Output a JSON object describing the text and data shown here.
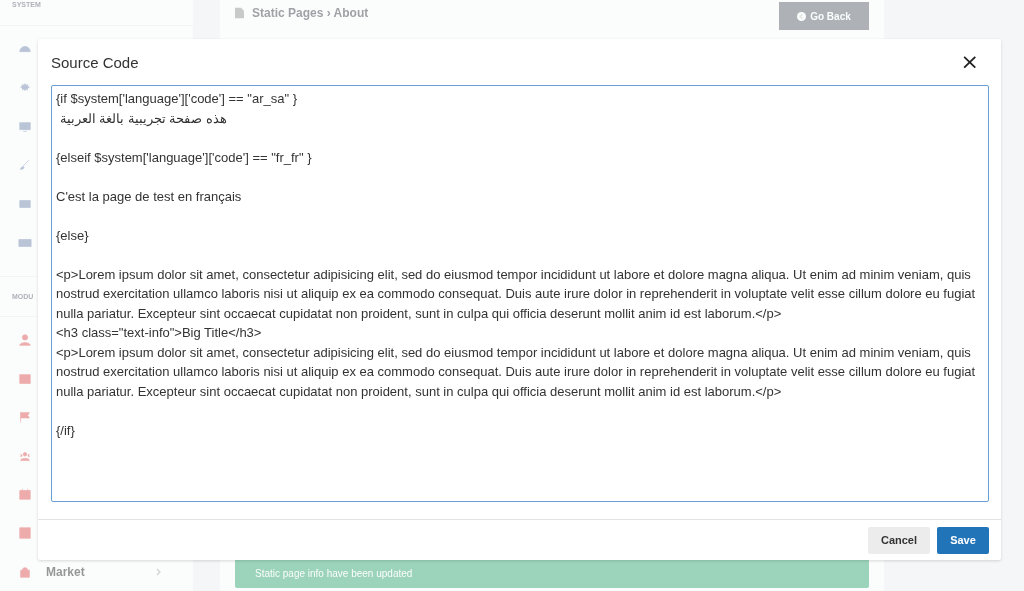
{
  "sidebar": {
    "sections": [
      {
        "label": "SYSTEM",
        "items": [
          {
            "kind": "link"
          },
          {
            "kind": "link"
          },
          {
            "kind": "link"
          },
          {
            "kind": "link"
          },
          {
            "kind": "link"
          },
          {
            "kind": "link"
          }
        ]
      },
      {
        "label": "MODU",
        "items": [
          {
            "kind": "link"
          },
          {
            "kind": "link"
          },
          {
            "kind": "link"
          },
          {
            "kind": "link"
          },
          {
            "kind": "link"
          },
          {
            "kind": "link"
          },
          {
            "kind": "menu",
            "label": "Market"
          }
        ]
      }
    ]
  },
  "breadcrumb": "Static Pages › About",
  "back_button": "Go Back",
  "alert": "Static page info have been updated",
  "modal": {
    "title": "Source Code",
    "close": "×",
    "editor": {
      "value": "{if $system['language']['code'] == \"ar_sa\" }\n هذه صفحة تجريبية بالغة العربية\n\n{elseif $system['language']['code'] == \"fr_fr\" }\n\nC'est la page de test en français\n\n{else}\n\n<p>Lorem ipsum dolor sit amet, consectetur adipisicing elit, sed do eiusmod tempor incididunt ut labore et dolore magna aliqua. Ut enim ad minim veniam, quis nostrud exercitation ullamco laboris nisi ut aliquip ex ea commodo consequat. Duis aute irure dolor in reprehenderit in voluptate velit esse cillum dolore eu fugiat nulla pariatur. Excepteur sint occaecat cupidatat non proident, sunt in culpa qui officia deserunt mollit anim id est laborum.</p>\n<h3 class=\"text-info\">Big Title</h3>\n<p>Lorem ipsum dolor sit amet, consectetur adipisicing elit, sed do eiusmod tempor incididunt ut labore et dolore magna aliqua. Ut enim ad minim veniam, quis nostrud exercitation ullamco laboris nisi ut aliquip ex ea commodo consequat. Duis aute irure dolor in reprehenderit in voluptate velit esse cillum dolore eu fugiat nulla pariatur. Excepteur sint occaecat cupidatat non proident, sunt in culpa qui officia deserunt mollit anim id est laborum.</p>\n\n{/if}"
    },
    "buttons": [
      {
        "label": "Cancel",
        "kind": "secondary"
      },
      {
        "label": "Save",
        "kind": "primary"
      }
    ]
  }
}
